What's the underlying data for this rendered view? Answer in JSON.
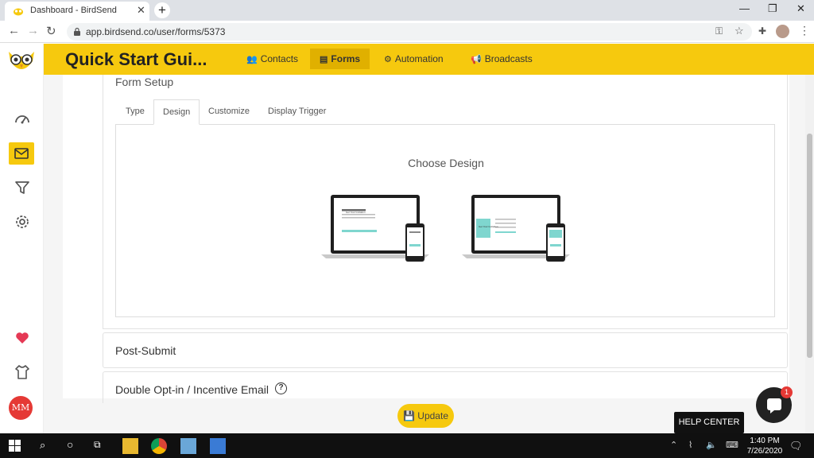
{
  "browser": {
    "tab_title": "Dashboard - BirdSend",
    "url": "app.birdsend.co/user/forms/5373"
  },
  "app": {
    "page_title": "Quick Start Gui...",
    "nav": [
      {
        "label": "Contacts",
        "icon": "users-icon"
      },
      {
        "label": "Forms",
        "icon": "form-icon",
        "active": true
      },
      {
        "label": "Automation",
        "icon": "gears-icon"
      },
      {
        "label": "Broadcasts",
        "icon": "megaphone-icon"
      }
    ],
    "sidebar": {
      "items": [
        "dashboard-icon",
        "mail-icon",
        "filter-icon",
        "settings-icon",
        "heart-icon",
        "shirt-icon"
      ],
      "avatar": "MM"
    }
  },
  "form_setup": {
    "title": "Form Setup",
    "tabs": [
      "Type",
      "Design",
      "Customize",
      "Display Trigger"
    ],
    "active_tab": "Design",
    "choose_design_label": "Choose Design",
    "design_preview_1_text": "Get Your Invitation",
    "design_preview_2_text": "Get Your Invitation"
  },
  "sections": {
    "post_submit": "Post-Submit",
    "double_opt_in": "Double Opt-in / Incentive Email"
  },
  "actions": {
    "update_label": "Update"
  },
  "widgets": {
    "chat_badge": "1",
    "help_center": "HELP CENTER"
  },
  "taskbar": {
    "time": "1:40 PM",
    "date": "7/26/2020"
  },
  "colors": {
    "accent": "#f6c90e",
    "accent_dark": "#e0b000",
    "avatar": "#e53935",
    "heart": "#e53955"
  }
}
